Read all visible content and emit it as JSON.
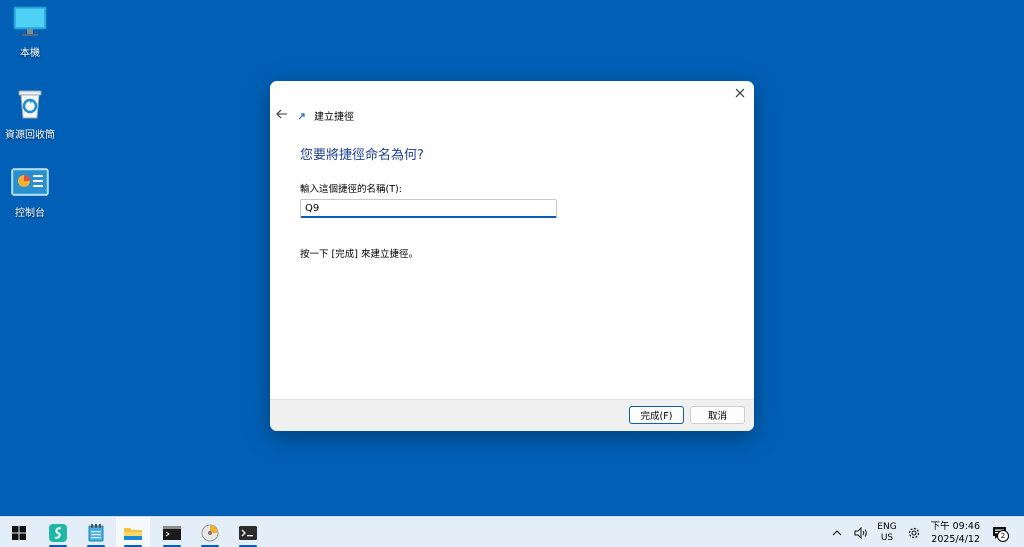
{
  "desktop": {
    "icons": [
      {
        "label": "本機"
      },
      {
        "label": "資源回收筒"
      },
      {
        "label": "控制台"
      }
    ]
  },
  "dialog": {
    "title": "建立捷徑",
    "heading": "您要將捷徑命名為何?",
    "field_label": "輸入這個捷徑的名稱(T):",
    "name_value": "Q9",
    "hint": "按一下 [完成] 來建立捷徑。",
    "finish_label": "完成(F)",
    "cancel_label": "取消"
  },
  "taskbar": {
    "language": {
      "line1": "ENG",
      "line2": "US"
    },
    "clock": {
      "time": "下午 09:46",
      "date": "2025/4/12"
    },
    "notification_count": "2"
  },
  "colors": {
    "desktop_bg": "#0160b6",
    "accent": "#0a5fb4",
    "heading": "#1c3f94",
    "taskbar_bg": "#e4eef8"
  }
}
